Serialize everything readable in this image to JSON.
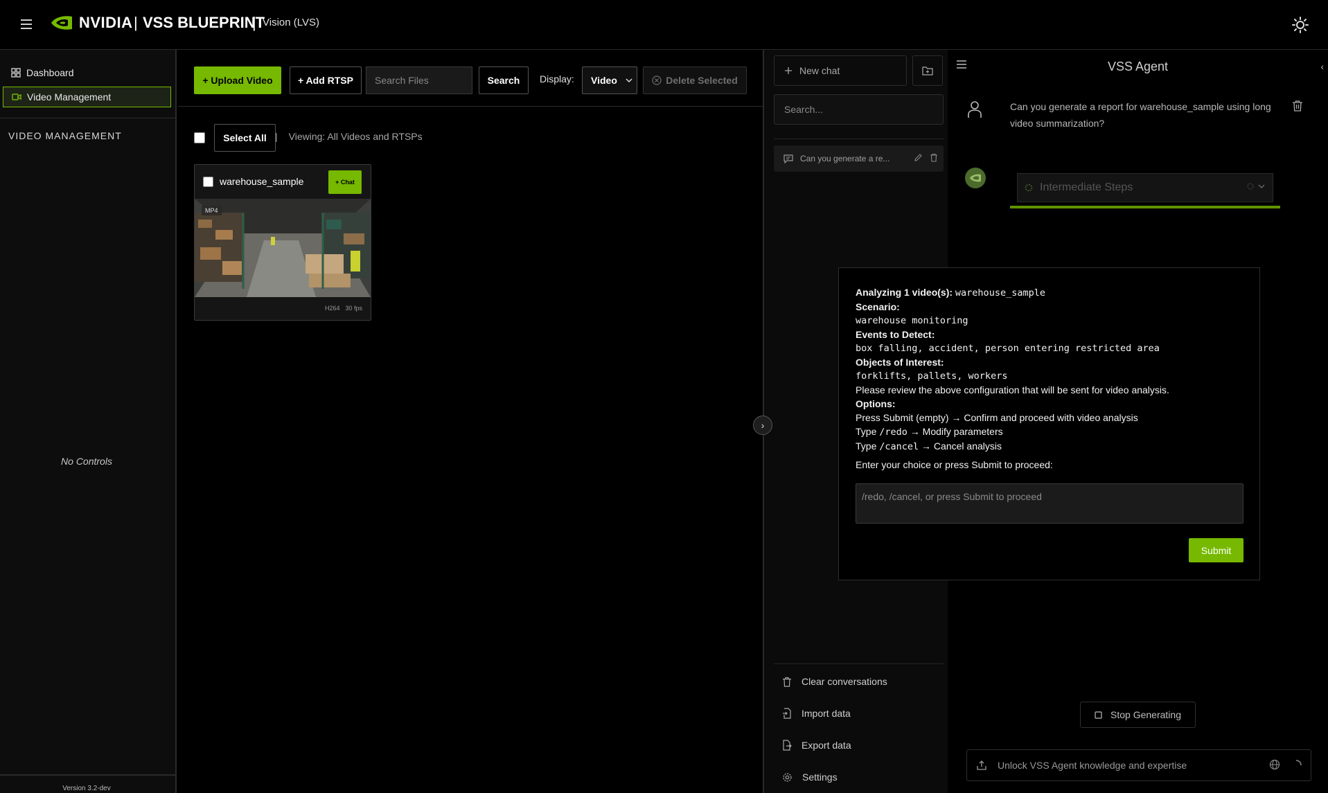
{
  "header": {
    "brand": "NVIDIA",
    "title": "VSS BLUEPRINT",
    "subtitle": "Vision (LVS)"
  },
  "sidebar": {
    "items": [
      {
        "label": "Dashboard",
        "icon": "dashboard-icon"
      },
      {
        "label": "Video Management",
        "icon": "video-icon",
        "active": true
      }
    ],
    "section_title": "VIDEO MANAGEMENT",
    "empty_text": "No Controls",
    "version": "Version 3.2-dev"
  },
  "toolbar": {
    "upload_label": "+ Upload Video",
    "rtsp_label": "+ Add RTSP",
    "search_placeholder": "Search Files",
    "search_label": "Search",
    "display_label": "Display:",
    "display_value": "Video",
    "delete_label": "Delete Selected"
  },
  "selection": {
    "select_all_label": "Select All",
    "separator": "|",
    "viewing_text": "Viewing: All Videos and RTSPs"
  },
  "video_card": {
    "name": "warehouse_sample",
    "chat_label": "+ Chat",
    "format": "MP4",
    "codec": "H264",
    "fps": "30 fps"
  },
  "chat_sidebar": {
    "new_chat_label": "New chat",
    "search_placeholder": "Search...",
    "conversation": "Can you generate a re...",
    "links": [
      "Clear conversations",
      "Import data",
      "Export data",
      "Settings"
    ]
  },
  "agent": {
    "title": "VSS Agent",
    "user_message": "Can you generate a report for warehouse_sample using long video summarization?",
    "steps_label": "Intermediate Steps",
    "stop_label": "Stop Generating",
    "input_placeholder": "Unlock VSS Agent knowledge and expertise"
  },
  "modal": {
    "analyzing_label": "Analyzing 1 video(s):",
    "analyzing_value": "warehouse_sample",
    "scenario_label": "Scenario:",
    "scenario_value": "warehouse monitoring",
    "events_label": "Events to Detect:",
    "events_value": "box falling, accident, person entering restricted area",
    "objects_label": "Objects of Interest:",
    "objects_value": "forklifts, pallets, workers",
    "review_text": "Please review the above configuration that will be sent for video analysis.",
    "options_label": "Options:",
    "option1": "Press Submit (empty) → Confirm and proceed with video analysis",
    "option2_pre": "Type ",
    "option2_code": "/redo",
    "option2_post": " → Modify parameters",
    "option3_pre": "Type ",
    "option3_code": "/cancel",
    "option3_post": " → Cancel analysis",
    "prompt": "Enter your choice or press Submit to proceed:",
    "input_placeholder": "/redo, /cancel, or press Submit to proceed",
    "submit_label": "Submit"
  },
  "colors": {
    "accent": "#76b900",
    "background": "#000000"
  }
}
